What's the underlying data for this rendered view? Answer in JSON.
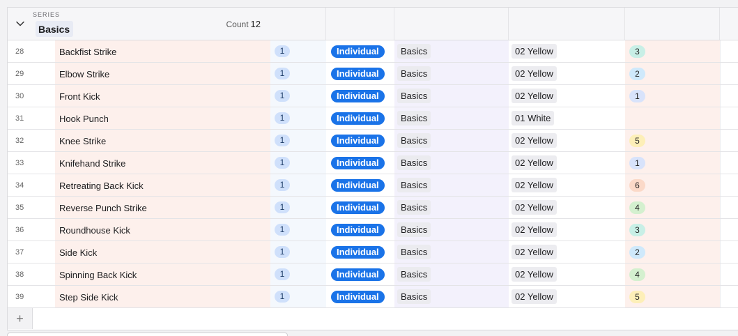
{
  "group": {
    "section_label": "SERIES",
    "name": "Basics",
    "count_label": "Count",
    "count_value": "12"
  },
  "colors": {
    "individual_pill": "#1a73e8",
    "name_column_bg": "#fdf0ec",
    "score_blue": "#cfe9fb",
    "score_teal": "#c8efe6",
    "score_yellow": "#fdefb8",
    "score_orange": "#fbd9c8",
    "score_green": "#d4f0cf"
  },
  "rows": [
    {
      "num": "28",
      "name": "Backfist Strike",
      "qty": "1",
      "type": "Individual",
      "series": "Basics",
      "level": "02 Yellow",
      "score": "3",
      "score_color": "#c8efe6"
    },
    {
      "num": "29",
      "name": "Elbow Strike",
      "qty": "1",
      "type": "Individual",
      "series": "Basics",
      "level": "02 Yellow",
      "score": "2",
      "score_color": "#cfe9fb"
    },
    {
      "num": "30",
      "name": "Front Kick",
      "qty": "1",
      "type": "Individual",
      "series": "Basics",
      "level": "02 Yellow",
      "score": "1",
      "score_color": "#d8e3fb"
    },
    {
      "num": "31",
      "name": "Hook Punch",
      "qty": "1",
      "type": "Individual",
      "series": "Basics",
      "level": "01 White",
      "score": "",
      "score_color": ""
    },
    {
      "num": "32",
      "name": "Knee Strike",
      "qty": "1",
      "type": "Individual",
      "series": "Basics",
      "level": "02 Yellow",
      "score": "5",
      "score_color": "#fdefb8"
    },
    {
      "num": "33",
      "name": "Knifehand Strike",
      "qty": "1",
      "type": "Individual",
      "series": "Basics",
      "level": "02 Yellow",
      "score": "1",
      "score_color": "#d8e3fb"
    },
    {
      "num": "34",
      "name": "Retreating Back Kick",
      "qty": "1",
      "type": "Individual",
      "series": "Basics",
      "level": "02 Yellow",
      "score": "6",
      "score_color": "#fbd9c8"
    },
    {
      "num": "35",
      "name": "Reverse Punch Strike",
      "qty": "1",
      "type": "Individual",
      "series": "Basics",
      "level": "02 Yellow",
      "score": "4",
      "score_color": "#d4f0cf"
    },
    {
      "num": "36",
      "name": "Roundhouse Kick",
      "qty": "1",
      "type": "Individual",
      "series": "Basics",
      "level": "02 Yellow",
      "score": "3",
      "score_color": "#c8efe6"
    },
    {
      "num": "37",
      "name": "Side Kick",
      "qty": "1",
      "type": "Individual",
      "series": "Basics",
      "level": "02 Yellow",
      "score": "2",
      "score_color": "#cfe9fb"
    },
    {
      "num": "38",
      "name": "Spinning Back Kick",
      "qty": "1",
      "type": "Individual",
      "series": "Basics",
      "level": "02 Yellow",
      "score": "4",
      "score_color": "#d4f0cf"
    },
    {
      "num": "39",
      "name": "Step Side Kick",
      "qty": "1",
      "type": "Individual",
      "series": "Basics",
      "level": "02 Yellow",
      "score": "5",
      "score_color": "#fdefb8"
    }
  ],
  "add_row_icon": "plus-icon"
}
